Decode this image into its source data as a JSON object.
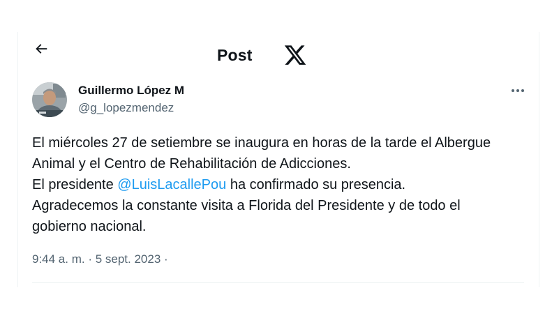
{
  "header": {
    "title": "Post",
    "back_icon": "arrow-left-icon",
    "logo_icon": "x-logo-icon"
  },
  "author": {
    "display_name": "Guillermo López M",
    "handle": "@g_lopezmendez",
    "avatar_icon": "user-avatar"
  },
  "tweet": {
    "line1": "El miércoles 27 de setiembre se inaugura en horas de la tarde el Albergue",
    "line2": "Animal y el Centro de Rehabilitación de Adicciones.",
    "line3_before": "El presidente ",
    "mention": "@LuisLacallePou",
    "line3_after": " ha confirmado su presencia.",
    "line4": "Agradecemos la constante visita a Florida del Presidente y de todo el",
    "line5": "gobierno nacional."
  },
  "meta": {
    "time": "9:44 a. m.",
    "sep1": " · ",
    "date": "5 sept. 2023",
    "sep2": " ·"
  },
  "colors": {
    "text": "#0f1419",
    "secondary": "#536471",
    "link": "#1d9bf0",
    "border": "#eff3f4"
  }
}
